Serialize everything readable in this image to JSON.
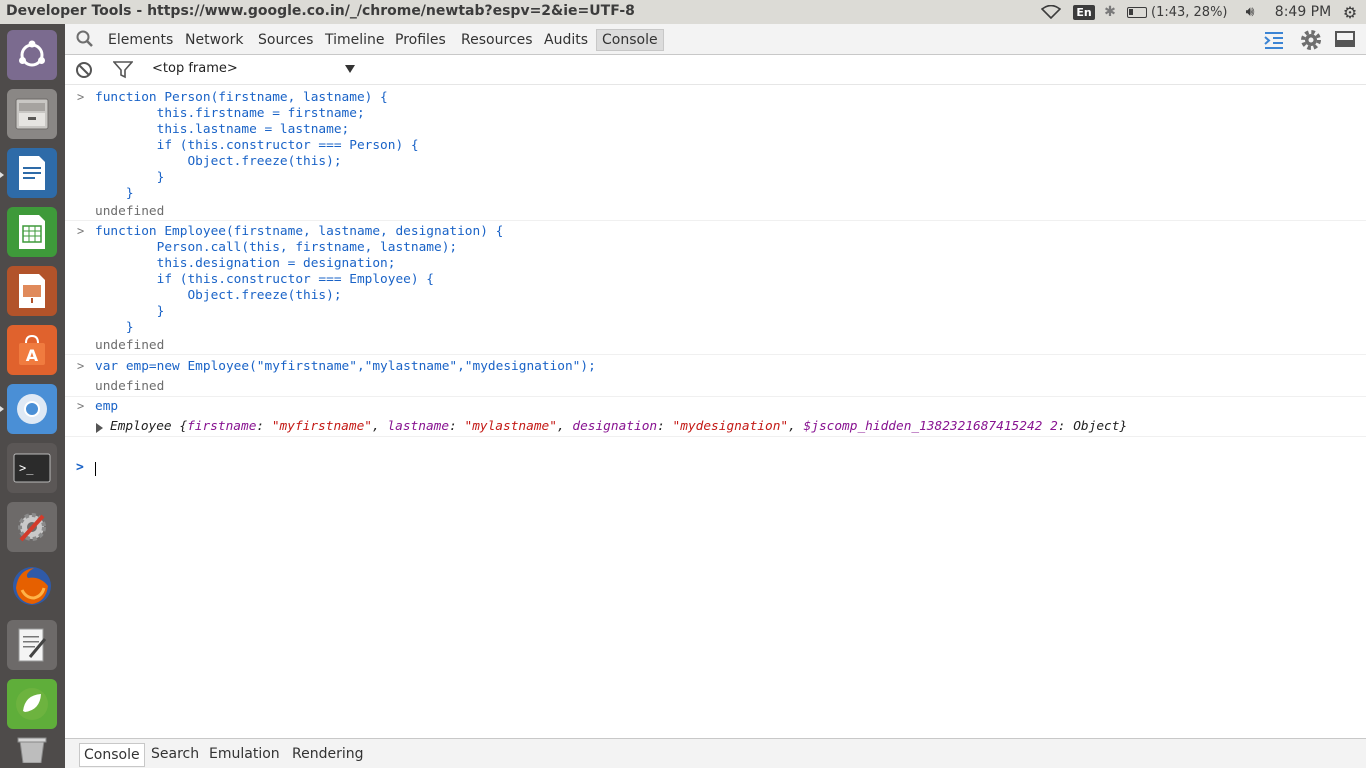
{
  "window": {
    "title": "Developer Tools - https://www.google.co.in/_/chrome/newtab?espv=2&ie=UTF-8"
  },
  "tray": {
    "language": "En",
    "battery": "(1:43, 28%)",
    "clock": "8:49 PM"
  },
  "launcher": {
    "items": [
      "ubuntu-dash",
      "files",
      "libreoffice-writer",
      "libreoffice-calc",
      "libreoffice-impress",
      "software-center",
      "chromium",
      "terminal",
      "system-settings",
      "firefox",
      "text-editor",
      "spring-tool-suite",
      "trash"
    ]
  },
  "devtools": {
    "tabs": [
      "Elements",
      "Network",
      "Sources",
      "Timeline",
      "Profiles",
      "Resources",
      "Audits",
      "Console"
    ],
    "active_tab": "Console",
    "frame_select": "<top frame>",
    "console": {
      "entries": [
        {
          "input": "function Person(firstname, lastname) {\n        this.firstname = firstname;\n        this.lastname = lastname;\n        if (this.constructor === Person) {\n            Object.freeze(this);\n        }\n    }",
          "result": "undefined"
        },
        {
          "input": "function Employee(firstname, lastname, designation) {\n        Person.call(this, firstname, lastname);\n        this.designation = designation;\n        if (this.constructor === Employee) {\n            Object.freeze(this);\n        }\n    }",
          "result": "undefined"
        },
        {
          "input": "var emp=new Employee(\"myfirstname\",\"mylastname\",\"mydesignation\");",
          "result": "undefined"
        },
        {
          "input": "emp",
          "object": {
            "class_name": "Employee",
            "open": " {",
            "k1": "firstname",
            "v1": "\"myfirstname\"",
            "k2": "lastname",
            "v2": "\"mylastname\"",
            "k3": "designation",
            "v3": "\"mydesignation\"",
            "k4": "$jscomp_hidden_1382321687415242 2",
            "v4": "Object",
            "close": "}"
          }
        }
      ]
    },
    "drawer_tabs": [
      "Console",
      "Search",
      "Emulation",
      "Rendering"
    ],
    "drawer_active": "Console"
  },
  "colors": {
    "code": "#1a63c7",
    "result": "#6e6e6e",
    "object_key": "#881391",
    "object_string": "#c41a16",
    "launcher_bg": "#4e4b4a",
    "panel_bg": "#dcdbd6"
  }
}
